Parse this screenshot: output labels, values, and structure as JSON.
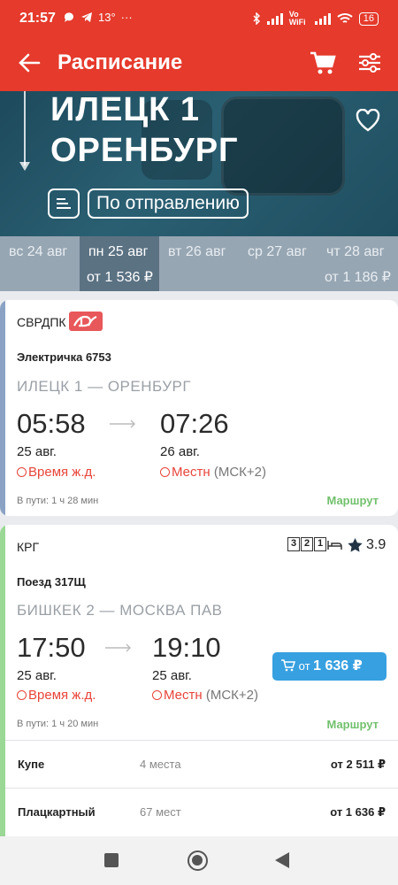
{
  "status": {
    "time": "21:57",
    "temp": "13°",
    "battery": "16",
    "network": "Vo WiFi"
  },
  "appbar": {
    "title": "Расписание"
  },
  "hero": {
    "from": "ИЛЕЦК 1",
    "to": "ОРЕНБУРГ",
    "sort_label": "По отправлению"
  },
  "dates": [
    {
      "day": "вс 24 авг",
      "price": ""
    },
    {
      "day": "пн 25 авг",
      "price": "от 1 536 ₽"
    },
    {
      "day": "вт 26 авг",
      "price": ""
    },
    {
      "day": "ср 27 авг",
      "price": ""
    },
    {
      "day": "чт 28 авг",
      "price": "от 1 186 ₽"
    }
  ],
  "trains": [
    {
      "carrier": "СВРДПК",
      "name": "Электричка 6753",
      "route": "ИЛЕЦК 1 — ОРЕНБУРГ",
      "dep_time": "05:58",
      "arr_time": "07:26",
      "dep_date": "25 авг.",
      "arr_date": "26 авг.",
      "dep_tz": "Время ж.д.",
      "arr_tz": "Местн",
      "arr_tz_note": "(МСК+2)",
      "travel": "В пути: 1 ч 28 мин",
      "route_link": "Маршрут",
      "stripe": "#8aa3c4"
    },
    {
      "carrier": "КРГ",
      "name": "Поезд 317Щ",
      "route": "БИШКЕК 2 — МОСКВА ПАВ",
      "dep_time": "17:50",
      "arr_time": "19:10",
      "dep_date": "25 авг.",
      "arr_date": "25 авг.",
      "dep_tz": "Время ж.д.",
      "arr_tz": "Местн",
      "arr_tz_note": "(МСК+2)",
      "travel": "В пути: 1 ч 20 мин",
      "route_link": "Маршрут",
      "rating": "3.9",
      "badges": [
        "3",
        "2",
        "1"
      ],
      "buy_prefix": "от",
      "buy_price": "1 636 ₽",
      "stripe": "#9bd895",
      "fares": [
        {
          "class": "Купе",
          "seats": "4 места",
          "price": "от 2 511 ₽"
        },
        {
          "class": "Плацкартный",
          "seats": "67 мест",
          "price": "от 1 636 ₽"
        }
      ]
    }
  ],
  "colors": {
    "brand": "#e53a2c",
    "buy": "#37a0e0",
    "route_link": "#72c06e",
    "tz": "#e8443a"
  }
}
